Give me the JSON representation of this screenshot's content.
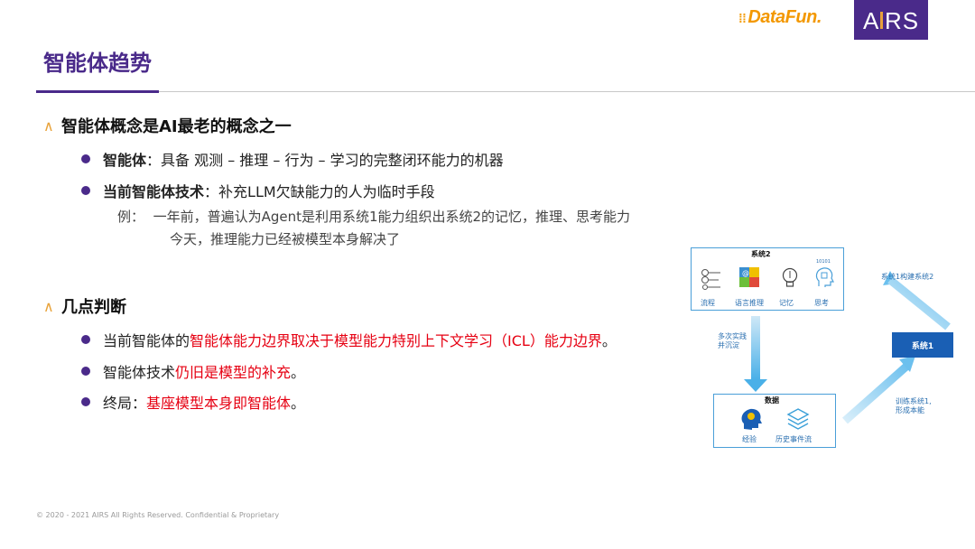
{
  "header": {
    "datafun_logo": "DataFun.",
    "airs_logo": "AIRS",
    "title": "智能体趋势"
  },
  "section1": {
    "heading": "智能体概念是AI最老的概念之一",
    "bullet1": {
      "term": "智能体",
      "sep": "：",
      "text": "具备 观测 – 推理 – 行为 – 学习的完整闭环能力的机器"
    },
    "bullet2": {
      "term": "当前智能体技术",
      "sep": "：",
      "text": "补充LLM欠缺能力的人为临时手段"
    },
    "example_prefix": "例：",
    "example_line1": "一年前，普遍认为Agent是利用系统1能力组织出系统2的记忆，推理、思考能力",
    "example_line2": "今天，推理能力已经被模型本身解决了"
  },
  "section2": {
    "heading": "几点判断",
    "point1": {
      "prefix": "当前智能体的",
      "highlight": "智能体能力边界取决于模型能力特别上下文学习（ICL）能力边界",
      "suffix": "。"
    },
    "point2": {
      "prefix": "智能体技术",
      "highlight": "仍旧是模型的补充",
      "suffix": "。"
    },
    "point3": {
      "prefix": "终局：",
      "highlight": "基座模型本身即智能体",
      "suffix": "。"
    }
  },
  "diagram": {
    "system2": {
      "title": "系统2",
      "items": [
        "流程",
        "语言推理",
        "记忆",
        "思考"
      ],
      "binary": "10101"
    },
    "data": {
      "title": "数据",
      "items": [
        "经验",
        "历史事件流"
      ]
    },
    "system1": {
      "label": "系统1"
    },
    "arrow_label_top": "系统1构建系统2",
    "arrow_label_left_1": "多次实践",
    "arrow_label_left_2": "并沉淀",
    "arrow_label_right_1": "训练系统1,",
    "arrow_label_right_2": "形成本能"
  },
  "footer": {
    "copyright": "© 2020 - 2021 AIRS All Rights Reserved. Confidential & Proprietary"
  },
  "colors": {
    "brand_purple": "#4a2a8a",
    "accent_orange": "#e8a23a",
    "highlight_red": "#e60012",
    "diagram_blue": "#4a9fd8"
  }
}
